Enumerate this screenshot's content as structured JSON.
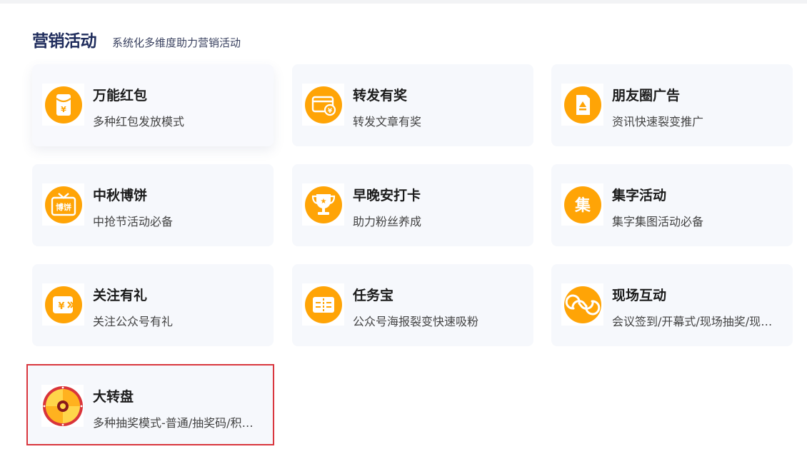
{
  "section": {
    "title": "营销活动",
    "subtitle": "系统化多维度助力营销活动"
  },
  "colors": {
    "accent_orange": "#ffa406",
    "title_navy": "#1f2c5c",
    "card_bg": "#f6f8fc",
    "selected_border": "#d9363e"
  },
  "cards": [
    {
      "title": "万能红包",
      "desc": "多种红包发放模式",
      "icon": "red-envelope-icon"
    },
    {
      "title": "转发有奖",
      "desc": "转发文章有奖",
      "icon": "share-reward-icon"
    },
    {
      "title": "朋友圈广告",
      "desc": "资讯快速裂变推广",
      "icon": "moments-ad-icon"
    },
    {
      "title": "中秋博饼",
      "desc": "中抢节活动必备",
      "icon": "mooncake-gift-icon"
    },
    {
      "title": "早晚安打卡",
      "desc": "助力粉丝养成",
      "icon": "trophy-icon"
    },
    {
      "title": "集字活动",
      "desc": "集字集图活动必备",
      "icon": "collect-characters-icon"
    },
    {
      "title": "关注有礼",
      "desc": "关注公众号有礼",
      "icon": "follow-gift-icon"
    },
    {
      "title": "任务宝",
      "desc": "公众号海报裂变快速吸粉",
      "icon": "task-ticket-icon"
    },
    {
      "title": "现场互动",
      "desc": "会议签到/开幕式/现场抽奖/现场互动",
      "icon": "live-interaction-icon"
    },
    {
      "title": "大转盘",
      "desc": "多种抽奖模式-普通/抽奖码/积分抽奖",
      "icon": "lucky-wheel-icon"
    }
  ]
}
